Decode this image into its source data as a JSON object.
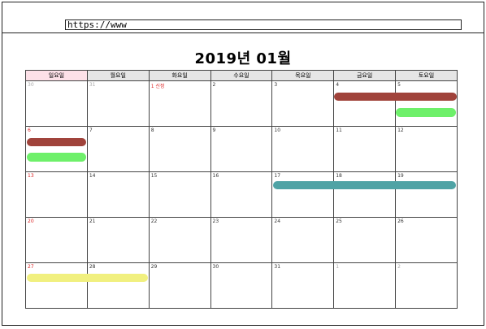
{
  "browser": {
    "url": "https://www"
  },
  "calendar": {
    "title": "2019년 01월",
    "weekdays": [
      "일요일",
      "월요일",
      "화요일",
      "수요일",
      "목요일",
      "금요일",
      "토요일"
    ],
    "weeks": [
      [
        "30",
        "31",
        "1 신정",
        "2",
        "3",
        "4",
        "5"
      ],
      [
        "6",
        "7",
        "8",
        "9",
        "10",
        "11",
        "12"
      ],
      [
        "13",
        "14",
        "15",
        "16",
        "17",
        "18",
        "19"
      ],
      [
        "20",
        "21",
        "22",
        "23",
        "24",
        "25",
        "26"
      ],
      [
        "27",
        "28",
        "29",
        "30",
        "31",
        "1",
        "2"
      ]
    ],
    "event_colors": {
      "brown": "#a0433b",
      "green": "#6ef06a",
      "teal": "#4fa3a5",
      "yellow": "#f1f07f"
    }
  }
}
